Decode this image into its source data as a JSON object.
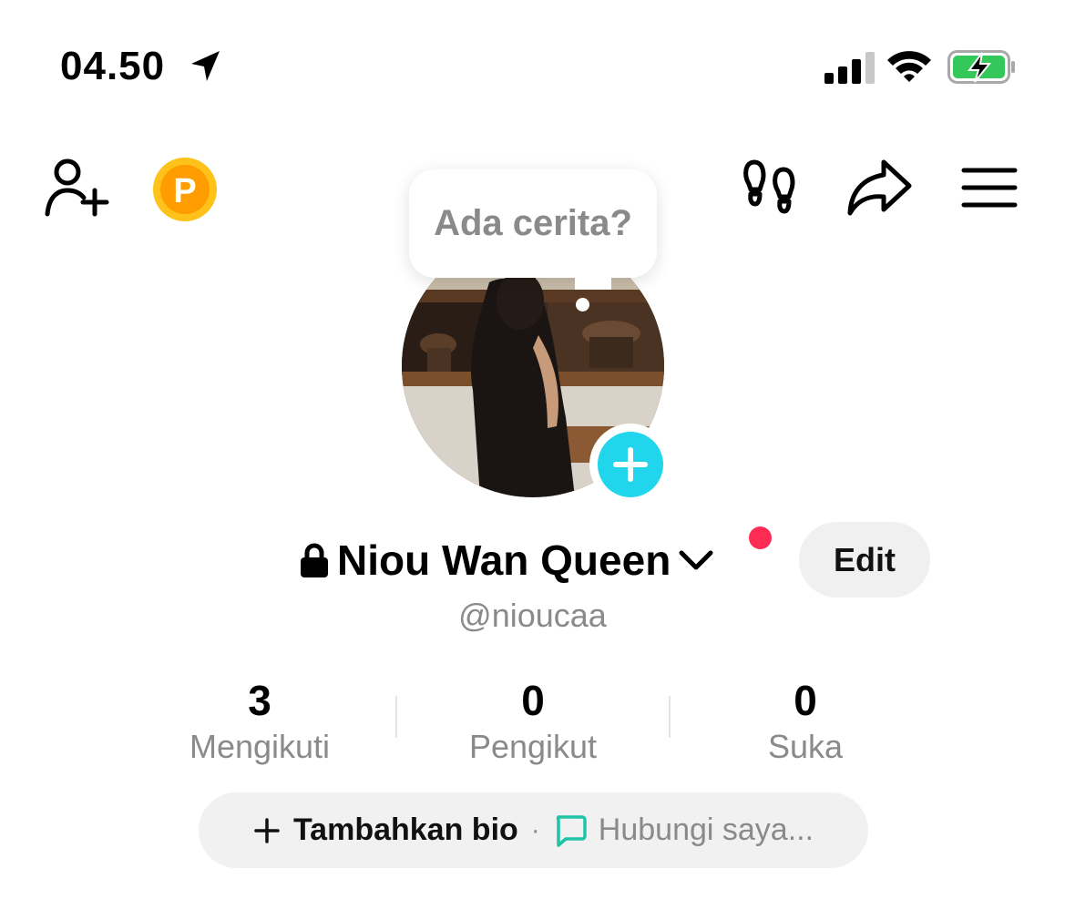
{
  "status_bar": {
    "time": "04.50",
    "icons": [
      "location-arrow-icon",
      "cellular-signal-icon",
      "wifi-icon",
      "battery-charging-icon"
    ],
    "battery_color": "#34c759"
  },
  "toolbar": {
    "icons": [
      "add-friend-icon",
      "coin-icon",
      "footprints-icon",
      "share-icon",
      "menu-icon"
    ],
    "coin_letter": "P",
    "coin_color": "#ff9d00"
  },
  "story": {
    "prompt": "Ada cerita?"
  },
  "profile": {
    "display_name": "Niou Wan Queen",
    "username": "@nioucaa",
    "edit_label": "Edit",
    "private_icon": "lock-icon",
    "accent_color": "#20d5ec",
    "notification_dot_color": "#fe2c55"
  },
  "stats": [
    {
      "value": "3",
      "label": "Mengikuti"
    },
    {
      "value": "0",
      "label": "Pengikut"
    },
    {
      "value": "0",
      "label": "Suka"
    }
  ],
  "bio": {
    "add_label": "Tambahkan bio",
    "separator": "·",
    "contact_label": "Hubungi saya...",
    "contact_icon_color": "#1ec4a4"
  }
}
